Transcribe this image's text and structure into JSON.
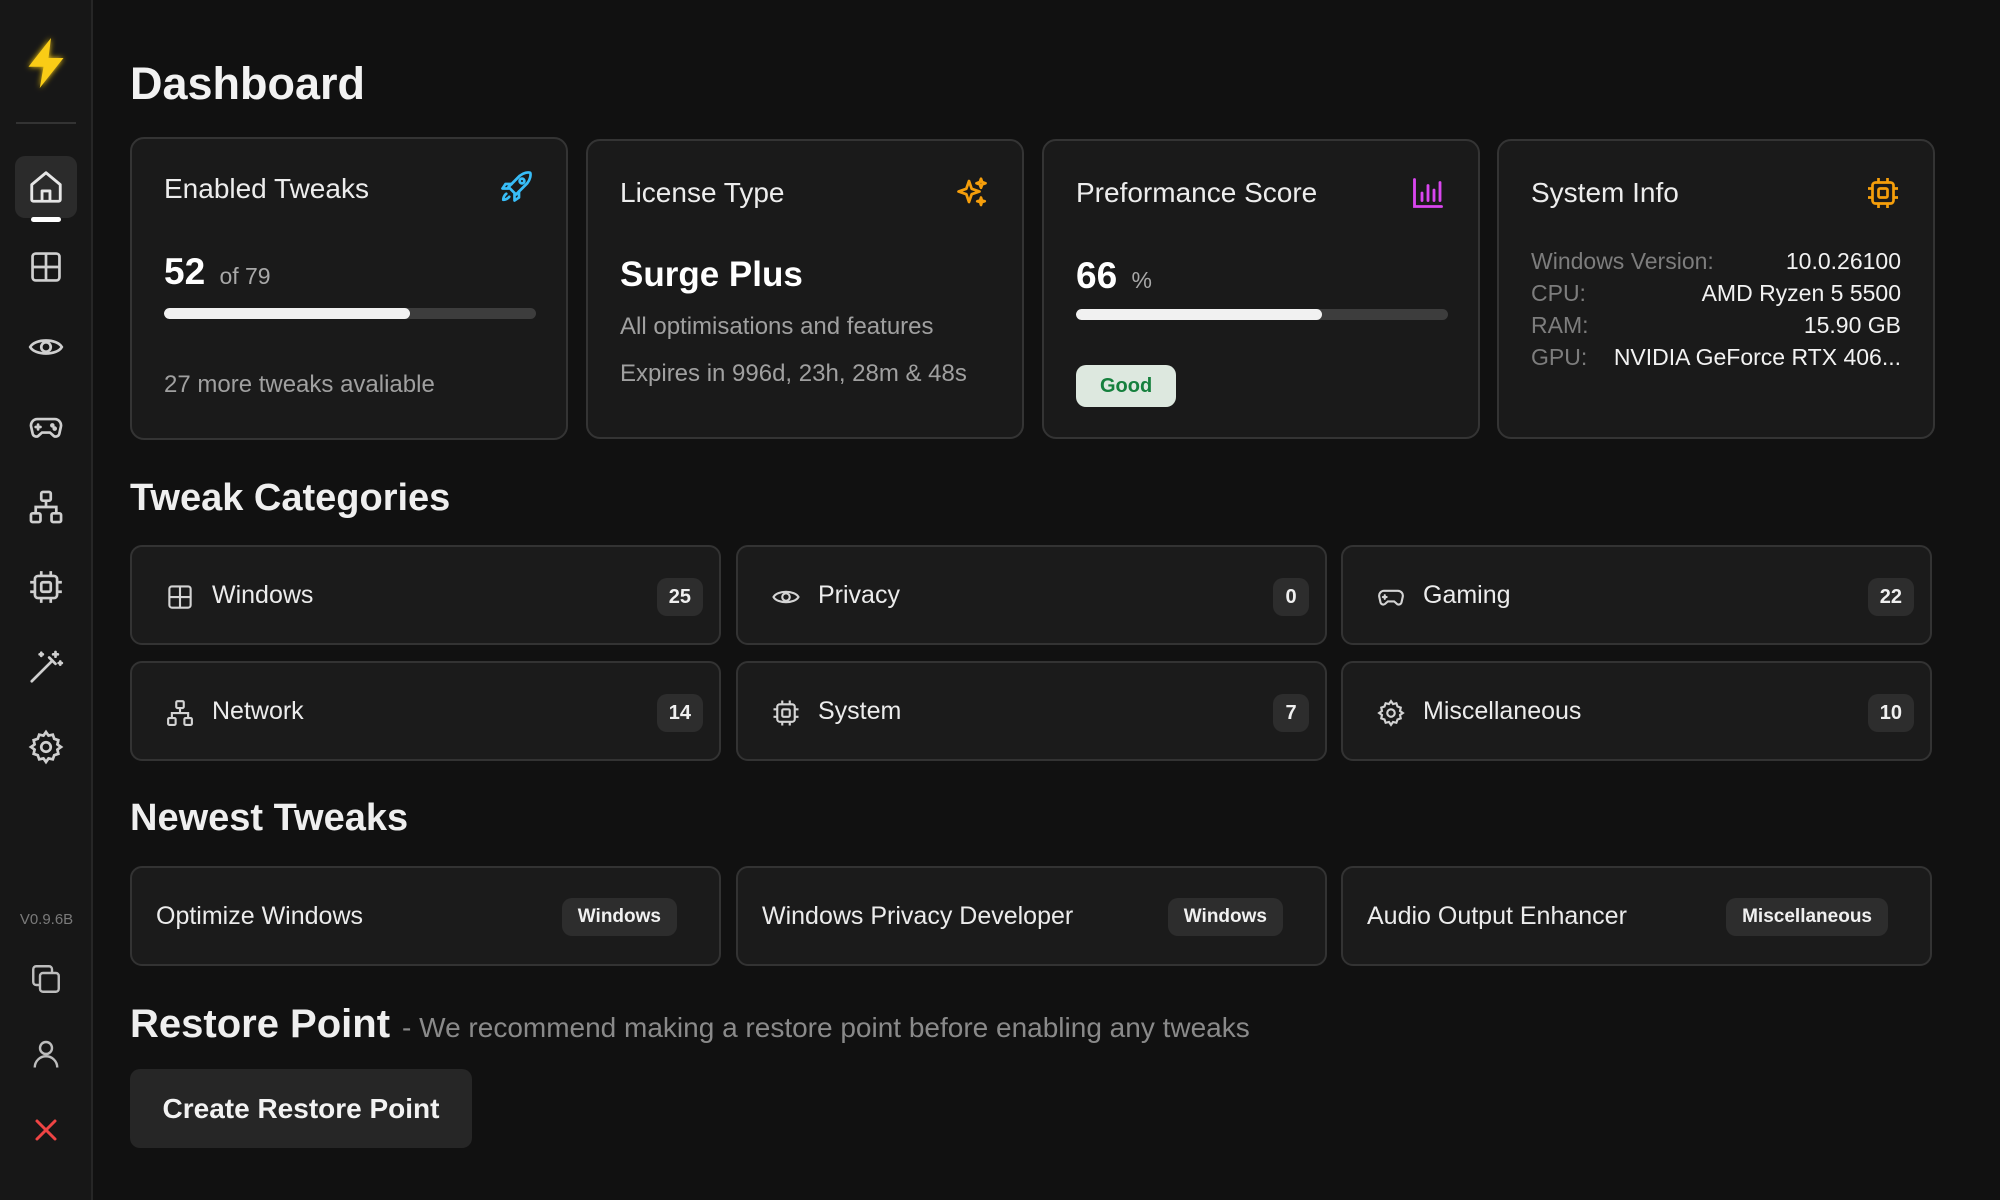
{
  "app": {
    "version": "V0.9.6B"
  },
  "sidebar": {
    "items": [
      {
        "name": "home-icon"
      },
      {
        "name": "windows-icon"
      },
      {
        "name": "eye-icon"
      },
      {
        "name": "gamepad-icon"
      },
      {
        "name": "network-icon"
      },
      {
        "name": "cpu-icon"
      },
      {
        "name": "magic-wand-icon"
      },
      {
        "name": "gear-icon"
      }
    ],
    "bottom": [
      {
        "name": "copy-icon"
      },
      {
        "name": "user-icon"
      },
      {
        "name": "close-icon"
      }
    ]
  },
  "page": {
    "title": "Dashboard"
  },
  "cards": {
    "tweaks": {
      "title": "Enabled Tweaks",
      "value": "52",
      "of": "of 79",
      "progress": 0.66,
      "note": "27 more tweaks avaliable",
      "icon": "rocket-icon",
      "icon_color": "#38bdf8"
    },
    "license": {
      "title": "License Type",
      "plan": "Surge Plus",
      "desc": "All optimisations and features",
      "expires": "Expires in 996d, 23h, 28m & 48s",
      "icon": "sparkles-icon",
      "icon_color": "#f59e0b"
    },
    "performance": {
      "title": "Preformance Score",
      "value": "66",
      "unit": "%",
      "progress": 0.66,
      "status": "Good",
      "icon": "bar-chart-icon",
      "icon_color": "#d946ef"
    },
    "system": {
      "title": "System Info",
      "icon": "cpu-chip-icon",
      "icon_color": "#f59e0b",
      "rows": [
        {
          "label": "Windows Version:",
          "value": "10.0.26100"
        },
        {
          "label": "CPU:",
          "value": "AMD Ryzen 5 5500"
        },
        {
          "label": "RAM:",
          "value": "15.90 GB"
        },
        {
          "label": "GPU:",
          "value": "NVIDIA GeForce RTX 406..."
        }
      ]
    }
  },
  "categories": {
    "title": "Tweak Categories",
    "items": [
      {
        "label": "Windows",
        "count": "25",
        "icon": "windows-icon"
      },
      {
        "label": "Privacy",
        "count": "0",
        "icon": "eye-icon"
      },
      {
        "label": "Gaming",
        "count": "22",
        "icon": "gamepad-icon"
      },
      {
        "label": "Network",
        "count": "14",
        "icon": "network-icon"
      },
      {
        "label": "System",
        "count": "7",
        "icon": "cpu-icon"
      },
      {
        "label": "Miscellaneous",
        "count": "10",
        "icon": "gear-icon"
      }
    ]
  },
  "newest": {
    "title": "Newest Tweaks",
    "items": [
      {
        "label": "Optimize Windows",
        "tag": "Windows"
      },
      {
        "label": "Windows Privacy Developer",
        "tag": "Windows"
      },
      {
        "label": "Audio Output Enhancer",
        "tag": "Miscellaneous"
      }
    ]
  },
  "restore": {
    "title": "Restore Point",
    "subtitle": "- We recommend making a restore point before enabling any tweaks",
    "button": "Create Restore Point"
  }
}
